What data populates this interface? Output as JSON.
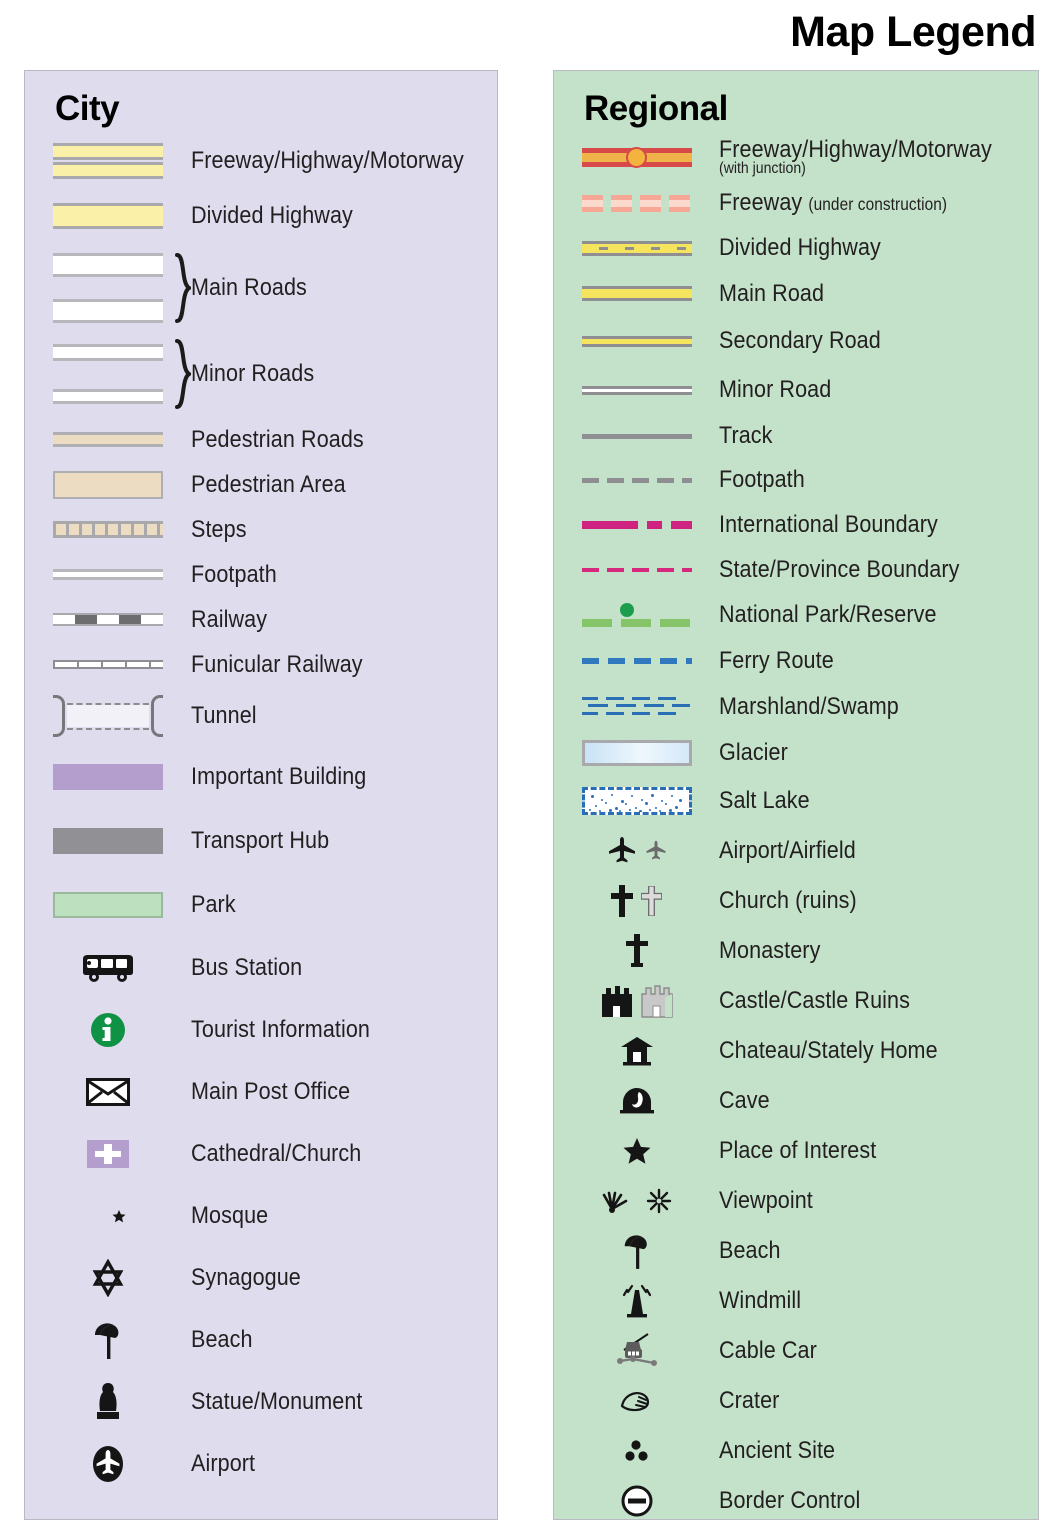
{
  "title": "Map Legend",
  "panels": {
    "city": {
      "heading": "City",
      "background": "#dedced",
      "items": [
        {
          "label": "Freeway/Highway/Motorway",
          "symbol": "city-freeway-swatch"
        },
        {
          "label": "Divided Highway",
          "symbol": "city-divided-highway-swatch"
        },
        {
          "label": "Main Roads",
          "symbol": "city-main-roads-swatch"
        },
        {
          "label": "Minor Roads",
          "symbol": "city-minor-roads-swatch"
        },
        {
          "label": "Pedestrian Roads",
          "symbol": "city-pedestrian-road-swatch"
        },
        {
          "label": "Pedestrian Area",
          "symbol": "city-pedestrian-area-swatch"
        },
        {
          "label": "Steps",
          "symbol": "city-steps-swatch"
        },
        {
          "label": "Footpath",
          "symbol": "city-footpath-swatch"
        },
        {
          "label": "Railway",
          "symbol": "city-railway-swatch"
        },
        {
          "label": "Funicular Railway",
          "symbol": "city-funicular-railway-swatch"
        },
        {
          "label": "Tunnel",
          "symbol": "city-tunnel-swatch"
        },
        {
          "label": "Important Building",
          "symbol": "city-important-building-swatch"
        },
        {
          "label": "Transport Hub",
          "symbol": "city-transport-hub-swatch"
        },
        {
          "label": "Park",
          "symbol": "city-park-swatch"
        },
        {
          "label": "Bus Station",
          "symbol": "bus-icon"
        },
        {
          "label": "Tourist Information",
          "symbol": "information-icon"
        },
        {
          "label": "Main Post Office",
          "symbol": "envelope-icon"
        },
        {
          "label": "Cathedral/Church",
          "symbol": "church-cross-icon"
        },
        {
          "label": "Mosque",
          "symbol": "crescent-star-icon"
        },
        {
          "label": "Synagogue",
          "symbol": "star-of-david-icon"
        },
        {
          "label": "Beach",
          "symbol": "beach-umbrella-icon"
        },
        {
          "label": "Statue/Monument",
          "symbol": "statue-icon"
        },
        {
          "label": "Airport",
          "symbol": "airport-icon"
        }
      ]
    },
    "regional": {
      "heading": "Regional",
      "background": "#c3e2c9",
      "items": [
        {
          "label": "Freeway/Highway/Motorway",
          "sublabel": "(with junction)",
          "symbol": "regional-freeway-line"
        },
        {
          "label": "Freeway",
          "suffix": "(under construction)",
          "symbol": "regional-freeway-construction-line"
        },
        {
          "label": "Divided Highway",
          "symbol": "regional-divided-highway-line"
        },
        {
          "label": "Main Road",
          "symbol": "regional-main-road-line"
        },
        {
          "label": "Secondary Road",
          "symbol": "regional-secondary-road-line"
        },
        {
          "label": "Minor Road",
          "symbol": "regional-minor-road-line"
        },
        {
          "label": "Track",
          "symbol": "regional-track-line"
        },
        {
          "label": "Footpath",
          "symbol": "regional-footpath-line"
        },
        {
          "label": "International Boundary",
          "symbol": "international-boundary-line"
        },
        {
          "label": "State/Province Boundary",
          "symbol": "state-boundary-line"
        },
        {
          "label": "National Park/Reserve",
          "symbol": "national-park-line"
        },
        {
          "label": "Ferry Route",
          "symbol": "ferry-route-line"
        },
        {
          "label": "Marshland/Swamp",
          "symbol": "marshland-swatch"
        },
        {
          "label": "Glacier",
          "symbol": "glacier-swatch"
        },
        {
          "label": "Salt Lake",
          "symbol": "salt-lake-swatch"
        },
        {
          "label": "Airport/Airfield",
          "symbol": "airplane-icon"
        },
        {
          "label": "Church (ruins)",
          "symbol": "cross-icon"
        },
        {
          "label": "Monastery",
          "symbol": "monastery-cross-icon"
        },
        {
          "label": "Castle/Castle Ruins",
          "symbol": "castle-icon"
        },
        {
          "label": "Chateau/Stately Home",
          "symbol": "chateau-icon"
        },
        {
          "label": "Cave",
          "symbol": "cave-icon"
        },
        {
          "label": "Place of Interest",
          "symbol": "star-icon"
        },
        {
          "label": "Viewpoint",
          "symbol": "viewpoint-icon"
        },
        {
          "label": "Beach",
          "symbol": "beach-umbrella-icon"
        },
        {
          "label": "Windmill",
          "symbol": "windmill-icon"
        },
        {
          "label": "Cable Car",
          "symbol": "cable-car-icon"
        },
        {
          "label": "Crater",
          "symbol": "crater-icon"
        },
        {
          "label": "Ancient Site",
          "symbol": "ancient-site-icon"
        },
        {
          "label": "Border Control",
          "symbol": "border-control-icon"
        }
      ]
    }
  },
  "colors": {
    "city_panel": "#dedced",
    "regional_panel": "#c3e2c9",
    "highway_yellow": "#fbf0a8",
    "pedestrian_tan": "#ecdcc2",
    "important_building": "#b49ecd",
    "transport_hub": "#919195",
    "park_green": "#bde0bf",
    "freeway_red": "#d8494a",
    "freeway_orange": "#f0b34a",
    "road_yellow": "#f5e45e",
    "boundary_magenta": "#cf2382",
    "park_line_green": "#86c46a",
    "ferry_blue": "#3179bf",
    "water_blue": "#2a6fb5",
    "info_green": "#1c9d4e"
  }
}
